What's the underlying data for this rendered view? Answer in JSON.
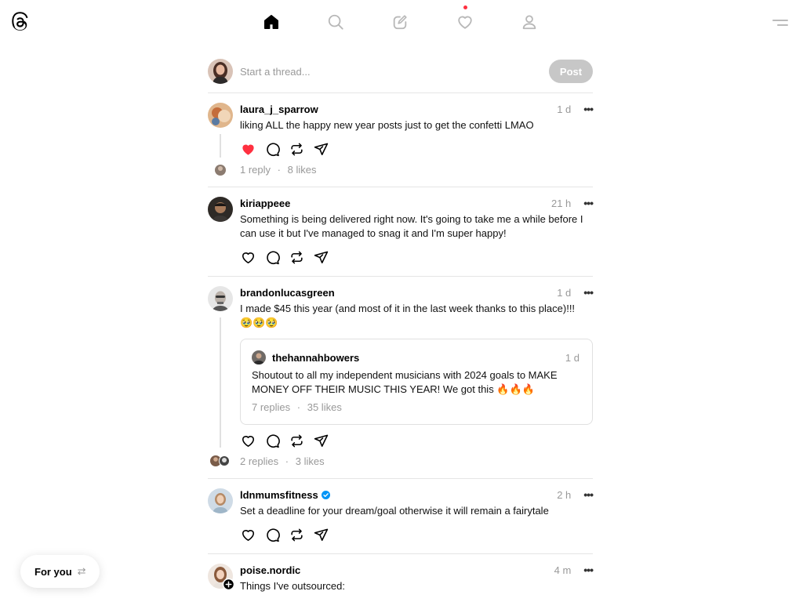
{
  "app": {
    "logo_icon": "threads-logo-icon"
  },
  "nav": {
    "items": [
      {
        "name": "home",
        "icon": "home-icon",
        "active": true
      },
      {
        "name": "search",
        "icon": "search-icon",
        "active": false
      },
      {
        "name": "compose",
        "icon": "compose-icon",
        "active": false
      },
      {
        "name": "activity",
        "icon": "heart-icon",
        "active": false,
        "notification": true
      },
      {
        "name": "profile",
        "icon": "profile-icon",
        "active": false
      }
    ],
    "menu_icon": "menu-icon"
  },
  "composer": {
    "placeholder": "Start a thread...",
    "post_label": "Post"
  },
  "threads": [
    {
      "username": "laura_j_sparrow",
      "time": "1 d",
      "text": "liking ALL the happy new year posts just to get the confetti LMAO",
      "liked": true,
      "replies": "1 reply",
      "likes": "8 likes",
      "stat_sep": "·"
    },
    {
      "username": "kiriappeee",
      "time": "21 h",
      "text": "Something is being delivered right now. It's going to take me a while before I can use it but I've managed to snag it and I'm super happy!",
      "liked": false
    },
    {
      "username": "brandonlucasgreen",
      "time": "1 d",
      "text": "I made $45 this year (and most of it in the last week thanks to this place)!!!",
      "emoji_line": "🥹🥹🥹",
      "quote": {
        "username": "thehannahbowers",
        "time": "1 d",
        "text": "Shoutout to all my independent musicians with 2024 goals to MAKE MONEY OFF THEIR MUSIC THIS YEAR! We got this",
        "emoji": "🔥🔥🔥",
        "replies": "7 replies",
        "likes": "35 likes",
        "stat_sep": "·"
      },
      "liked": false,
      "replies": "2 replies",
      "likes": "3 likes",
      "stat_sep": "·"
    },
    {
      "username": "ldnmumsfitness",
      "verified": true,
      "time": "2 h",
      "text": "Set a deadline for your dream/goal otherwise it will remain a fairytale",
      "liked": false
    },
    {
      "username": "poise.nordic",
      "time": "4 m",
      "text": "Things I've outsourced:"
    }
  ],
  "feed_switch": {
    "label": "For you",
    "icon": "swap-icon"
  },
  "colors": {
    "like": "#ff3040",
    "verified": "#0095f6",
    "muted": "#999999",
    "post_button": "#c7c7c7"
  }
}
